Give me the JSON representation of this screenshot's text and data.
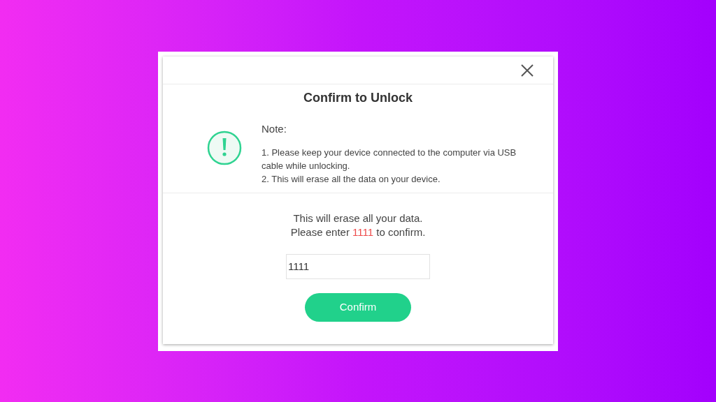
{
  "dialog": {
    "title": "Confirm to Unlock",
    "note": {
      "heading": "Note:",
      "lines": [
        "1. Please keep your device connected to the computer via USB cable while unlocking.",
        "2. This will erase all the data on your device."
      ]
    },
    "warning": "This will erase all your data.",
    "instruction": {
      "before": "Please enter ",
      "code": "1111",
      "after": " to confirm."
    },
    "input": {
      "value": "1111"
    },
    "button": "Confirm"
  }
}
